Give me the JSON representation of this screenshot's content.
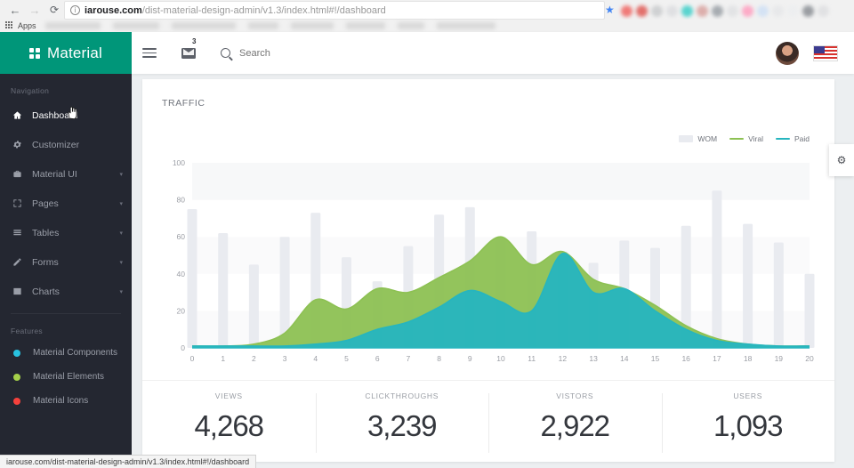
{
  "browser": {
    "back_icon": "arrow-left-icon",
    "forward_icon": "arrow-right-icon",
    "reload_icon": "reload-icon",
    "home_icon": "home-icon",
    "info_icon": "info-icon",
    "url_host": "iarouse.com",
    "url_path": "/dist-material-design-admin/v1.3/index.html#!/dashboard",
    "star_icon": "bookmark-star-icon",
    "apps_label": "Apps",
    "apps_icon": "apps-grid-icon",
    "status_tooltip": "iarouse.com/dist-material-design-admin/v1.3/index.html#!/dashboard",
    "extension_colors": [
      "#f06663",
      "#e05a55",
      "#c9cbcd",
      "#dcdde0",
      "#3ecfc9",
      "#d9a3a0",
      "#9aa0a6",
      "#e0e1e3",
      "#ff9fc0",
      "#cfe0f5",
      "#e6e7e9",
      "#eceef0",
      "#8b8f95",
      "#dedfe1"
    ],
    "bookmark_widths": [
      62,
      52,
      72,
      34,
      48,
      44,
      30,
      66
    ]
  },
  "sidebar": {
    "brand": "Material",
    "brand_icon": "material-logo-icon",
    "brand_color": "#009679",
    "background": "#242731",
    "sections": [
      {
        "title": "Navigation",
        "items": [
          {
            "label": "Dashboard",
            "icon": "home-icon",
            "active": true,
            "caret": false
          },
          {
            "label": "Customizer",
            "icon": "gear-icon",
            "active": false,
            "caret": false
          },
          {
            "label": "Material UI",
            "icon": "briefcase-icon",
            "active": false,
            "caret": true
          },
          {
            "label": "Pages",
            "icon": "expand-icon",
            "active": false,
            "caret": true
          },
          {
            "label": "Tables",
            "icon": "table-icon",
            "active": false,
            "caret": true
          },
          {
            "label": "Forms",
            "icon": "pencil-icon",
            "active": false,
            "caret": true
          },
          {
            "label": "Charts",
            "icon": "chart-icon",
            "active": false,
            "caret": true
          }
        ]
      },
      {
        "title": "Features",
        "items": [
          {
            "label": "Material Components",
            "dot": "#28c2e0"
          },
          {
            "label": "Material Elements",
            "dot": "#a5d04a"
          },
          {
            "label": "Material Icons",
            "dot": "#f5413c"
          }
        ]
      }
    ]
  },
  "appbar": {
    "menu_icon": "hamburger-menu-icon",
    "mail_icon": "mail-icon",
    "mail_badge": "3",
    "search_icon": "search-icon",
    "search_placeholder": "Search",
    "search_value": "",
    "avatar_icon": "user-avatar",
    "flag_icon": "us-flag-icon"
  },
  "main": {
    "card_title": "TRAFFIC",
    "gear_tab_icon": "settings-gear-icon",
    "stats": [
      {
        "label": "VIEWS",
        "value": "4,268"
      },
      {
        "label": "CLICKTHROUGHS",
        "value": "3,239"
      },
      {
        "label": "VISTORS",
        "value": "2,922"
      },
      {
        "label": "USERS",
        "value": "1,093"
      }
    ]
  },
  "chart_data": {
    "type": "area",
    "title": "TRAFFIC",
    "xlabel": "",
    "ylabel": "",
    "xlim": [
      0,
      20
    ],
    "ylim": [
      0,
      100
    ],
    "yticks": [
      0,
      20,
      40,
      60,
      80,
      100
    ],
    "xticks": [
      0,
      1,
      2,
      3,
      4,
      5,
      6,
      7,
      8,
      9,
      10,
      11,
      12,
      13,
      14,
      15,
      16,
      17,
      18,
      19,
      20
    ],
    "grid": true,
    "legend_position": "top-right",
    "x": [
      0,
      1,
      2,
      3,
      4,
      5,
      6,
      7,
      8,
      9,
      10,
      11,
      12,
      13,
      14,
      15,
      16,
      17,
      18,
      19,
      20
    ],
    "series": [
      {
        "name": "WOM",
        "type": "bar",
        "color": "#e9ebf0",
        "values": [
          75,
          62,
          45,
          60,
          73,
          49,
          36,
          55,
          72,
          76,
          60,
          63,
          52,
          46,
          58,
          54,
          66,
          85,
          67,
          57,
          40
        ]
      },
      {
        "name": "Viral",
        "type": "area",
        "color": "#8dc153",
        "values": [
          1,
          1,
          2,
          8,
          26,
          21,
          32,
          30,
          38,
          47,
          60,
          45,
          52,
          37,
          32,
          23,
          12,
          5,
          2,
          1,
          1
        ]
      },
      {
        "name": "Paid",
        "type": "area",
        "color": "#26b5bf",
        "values": [
          1,
          1,
          1,
          1,
          2,
          4,
          10,
          14,
          22,
          31,
          25,
          20,
          51,
          30,
          32,
          20,
          10,
          4,
          2,
          1,
          1
        ]
      }
    ]
  }
}
